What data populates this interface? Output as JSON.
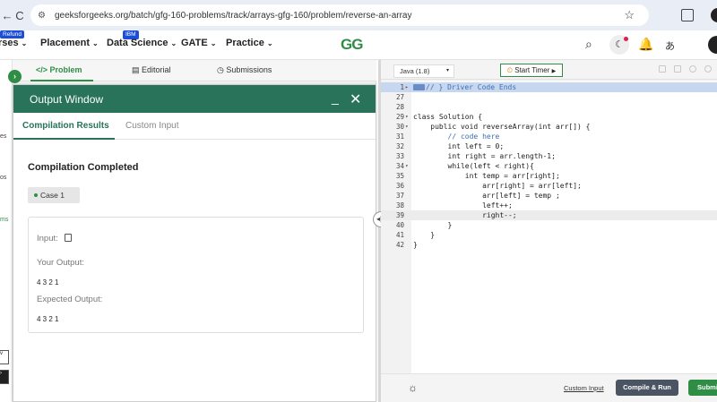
{
  "browser": {
    "back_glyph": "←",
    "reload_glyph": "C",
    "url": "geeksforgeeks.org/batch/gfg-160-problems/track/arrays-gfg-160/problem/reverse-an-array",
    "tune_icon": "tune-icon",
    "star_glyph": "☆"
  },
  "header": {
    "refund_badge": "Refund",
    "courses_label": "rses",
    "placement_label": "Placement",
    "ibm_badge": "IBM",
    "data_science_label": "Data Science",
    "gate_label": "GATE",
    "practice_label": "Practice",
    "logo_text": "GG",
    "search_glyph": "🔍",
    "moon_glyph": "☾",
    "bell_glyph": "🔔",
    "translate_glyph": "あ",
    "chevron": "⌄"
  },
  "left_strip": {
    "collapse_glyph": "›",
    "text_1": "es",
    "text_2": "os",
    "text_3": "ms",
    "btn_1": "v",
    "btn_2": "›"
  },
  "problem_tabs": {
    "problem": "</> Problem",
    "editorial": "Editorial",
    "submissions": "Submissions",
    "editorial_icon": "▤",
    "submissions_icon": "◷"
  },
  "output_window": {
    "title": "Output Window",
    "minimize_glyph": "_",
    "close_glyph": "✕",
    "tabs": {
      "compilation_results": "Compilation Results",
      "custom_input": "Custom Input"
    },
    "status": "Compilation Completed",
    "case_label": "Case 1",
    "input_label": "Input:",
    "your_output_label": "Your Output:",
    "your_output_value": "4 3 2 1",
    "expected_output_label": "Expected Output:",
    "expected_output_value": "4 3 2 1"
  },
  "splitter": {
    "handle_glyph": "◂|▸"
  },
  "editor": {
    "language": "Java (1.8)",
    "language_caret": "▾",
    "start_timer": "Start Timer",
    "timer_icon_glyph": "⏲",
    "play_glyph": "▶",
    "lines": [
      {
        "n": "1",
        "fold": "▸",
        "text": "// } Driver Code Ends",
        "highlight": "blue",
        "foldmark": true
      },
      {
        "n": "27",
        "fold": "",
        "text": "",
        "highlight": ""
      },
      {
        "n": "28",
        "fold": "",
        "text": "",
        "highlight": ""
      },
      {
        "n": "29",
        "fold": "▾",
        "text": "class Solution {",
        "highlight": ""
      },
      {
        "n": "30",
        "fold": "▾",
        "text": "    public void reverseArray(int arr[]) {",
        "highlight": ""
      },
      {
        "n": "31",
        "fold": "",
        "text": "        // code here",
        "highlight": ""
      },
      {
        "n": "32",
        "fold": "",
        "text": "        int left = 0;",
        "highlight": ""
      },
      {
        "n": "33",
        "fold": "",
        "text": "        int right = arr.length-1;",
        "highlight": ""
      },
      {
        "n": "34",
        "fold": "▾",
        "text": "        while(left < right){",
        "highlight": ""
      },
      {
        "n": "35",
        "fold": "",
        "text": "            int temp = arr[right];",
        "highlight": ""
      },
      {
        "n": "36",
        "fold": "",
        "text": "                arr[right] = arr[left];",
        "highlight": ""
      },
      {
        "n": "37",
        "fold": "",
        "text": "                arr[left] = temp ;",
        "highlight": ""
      },
      {
        "n": "38",
        "fold": "",
        "text": "                left++;",
        "highlight": ""
      },
      {
        "n": "39",
        "fold": "",
        "text": "                right--;",
        "highlight": "gray"
      },
      {
        "n": "40",
        "fold": "",
        "text": "        }",
        "highlight": ""
      },
      {
        "n": "41",
        "fold": "",
        "text": "    }",
        "highlight": ""
      },
      {
        "n": "42",
        "fold": "",
        "text": "}",
        "highlight": ""
      }
    ],
    "bulb_glyph": "☼",
    "custom_input_link": "Custom Input",
    "compile_run": "Compile & Run",
    "submit": "Submit"
  },
  "colors": {
    "brand_green": "#2f8d46",
    "output_header": "#28735a",
    "run_button": "#4a5462"
  }
}
